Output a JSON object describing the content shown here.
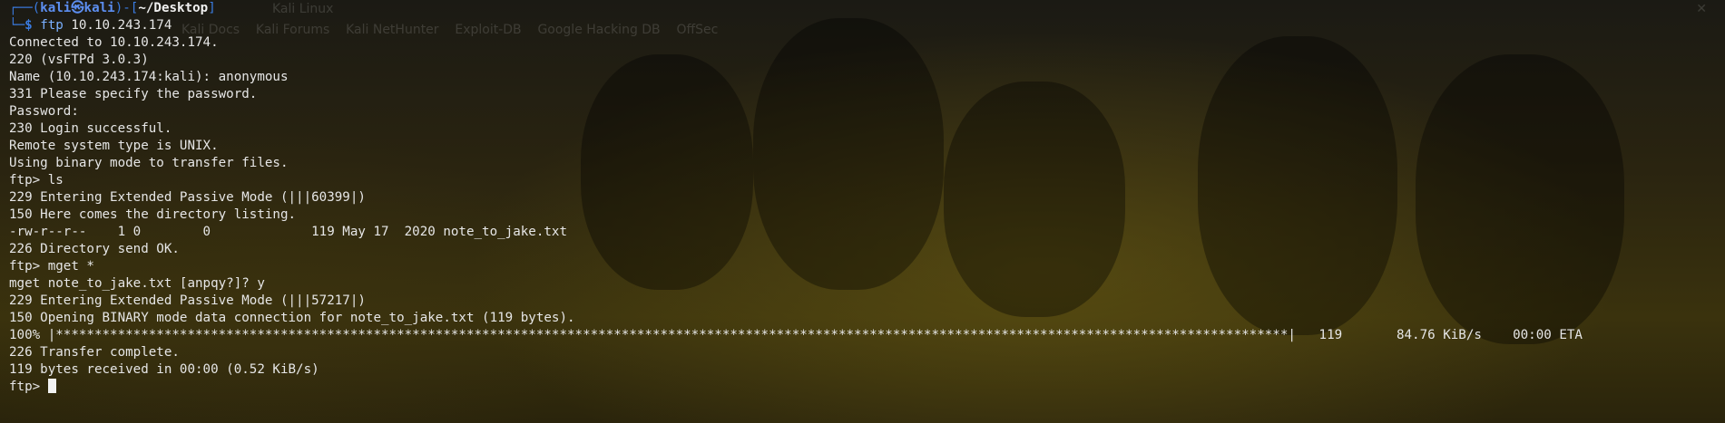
{
  "ghost_overlay": {
    "tab_title": "Kali Linux",
    "bookmarks": "Kali Docs    Kali Forums    Kali NetHunter    Exploit-DB    Google Hacking DB    OffSec"
  },
  "prompt": {
    "frame_top": "┌──(",
    "user": "kali㉿kali",
    "sep": ")-[",
    "path": "~/Desktop",
    "close": "]",
    "frame_bottom": "└─",
    "dollar": "$ ",
    "command": "ftp",
    "args": " 10.10.243.174"
  },
  "output": [
    "Connected to 10.10.243.174.",
    "220 (vsFTPd 3.0.3)",
    "Name (10.10.243.174:kali): anonymous",
    "331 Please specify the password.",
    "Password: ",
    "230 Login successful.",
    "Remote system type is UNIX.",
    "Using binary mode to transfer files.",
    "ftp> ls",
    "229 Entering Extended Passive Mode (|||60399|)",
    "150 Here comes the directory listing.",
    "-rw-r--r--    1 0        0             119 May 17  2020 note_to_jake.txt",
    "226 Directory send OK.",
    "ftp> mget *",
    "mget note_to_jake.txt [anpqy?]? y",
    "229 Entering Extended Passive Mode (|||57217|)",
    "150 Opening BINARY mode data connection for note_to_jake.txt (119 bytes).",
    "100% |***************************************************************************************************************************************************************|   119       84.76 KiB/s    00:00 ETA",
    "226 Transfer complete.",
    "119 bytes received in 00:00 (0.52 KiB/s)"
  ],
  "final_prompt": "ftp> "
}
